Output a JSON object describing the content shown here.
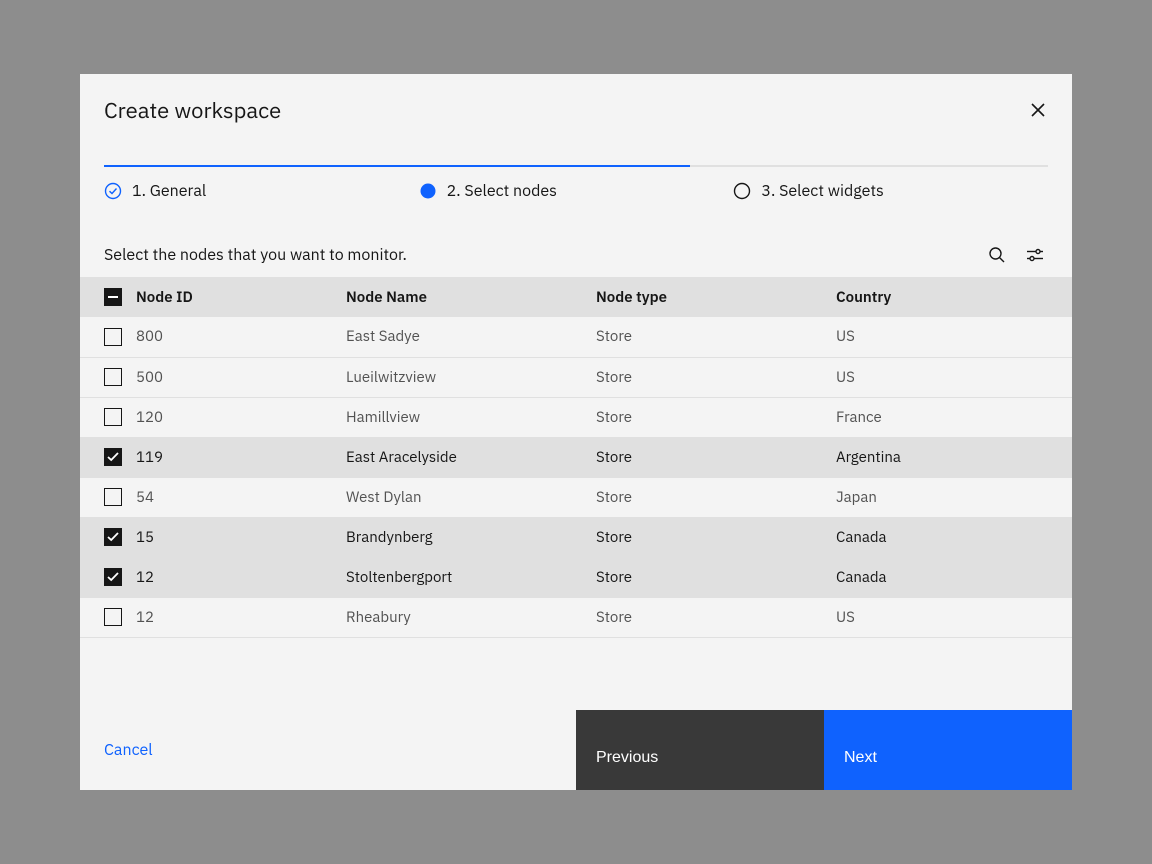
{
  "modal": {
    "title": "Create workspace"
  },
  "steps": [
    {
      "n": "1.",
      "label": "General"
    },
    {
      "n": "2.",
      "label": "Select nodes"
    },
    {
      "n": "3.",
      "label": "Select widgets"
    }
  ],
  "instruction": "Select the nodes that you want to monitor.",
  "columns": {
    "id": "Node ID",
    "name": "Node Name",
    "type": "Node type",
    "country": "Country"
  },
  "rows": [
    {
      "id": "800",
      "name": "East Sadye",
      "type": "Store",
      "country": "US",
      "selected": false
    },
    {
      "id": "500",
      "name": "Lueilwitzview",
      "type": "Store",
      "country": "US",
      "selected": false
    },
    {
      "id": "120",
      "name": "Hamillview",
      "type": "Store",
      "country": "France",
      "selected": false
    },
    {
      "id": "119",
      "name": "East Aracelyside",
      "type": "Store",
      "country": "Argentina",
      "selected": true
    },
    {
      "id": "54",
      "name": "West Dylan",
      "type": "Store",
      "country": "Japan",
      "selected": false
    },
    {
      "id": "15",
      "name": "Brandynberg",
      "type": "Store",
      "country": "Canada",
      "selected": true
    },
    {
      "id": "12",
      "name": "Stoltenbergport",
      "type": "Store",
      "country": "Canada",
      "selected": true
    },
    {
      "id": "12",
      "name": "Rheabury",
      "type": "Store",
      "country": "US",
      "selected": false
    }
  ],
  "footer": {
    "cancel": "Cancel",
    "previous": "Previous",
    "next": "Next"
  },
  "colors": {
    "accent": "#0f62fe",
    "secondary": "#393939"
  }
}
